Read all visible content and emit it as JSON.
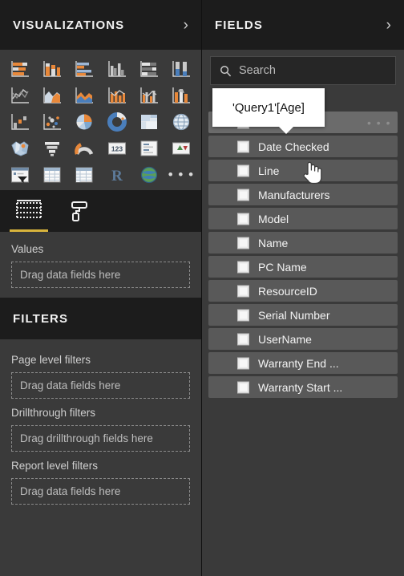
{
  "visualizations": {
    "title": "VISUALIZATIONS",
    "collapse_icon": "chevron-right-icon",
    "chevron": "›",
    "icons": [
      {
        "name": "stacked-bar-chart",
        "kind": "stacked-bar"
      },
      {
        "name": "stacked-column-chart",
        "kind": "stacked-column"
      },
      {
        "name": "clustered-bar-chart",
        "kind": "clustered-bar"
      },
      {
        "name": "clustered-column-chart",
        "kind": "clustered-column"
      },
      {
        "name": "hundred-percent-stacked-bar-chart",
        "kind": "pct-bar"
      },
      {
        "name": "hundred-percent-stacked-column-chart",
        "kind": "pct-column"
      },
      {
        "name": "line-chart",
        "kind": "line"
      },
      {
        "name": "area-chart",
        "kind": "area"
      },
      {
        "name": "stacked-area-chart",
        "kind": "stacked-area"
      },
      {
        "name": "line-and-stacked-column-chart",
        "kind": "line-stacked-column"
      },
      {
        "name": "line-and-clustered-column-chart",
        "kind": "line-clustered-column"
      },
      {
        "name": "ribbon-chart",
        "kind": "ribbon"
      },
      {
        "name": "waterfall-chart",
        "kind": "waterfall"
      },
      {
        "name": "scatter-chart",
        "kind": "scatter"
      },
      {
        "name": "pie-chart",
        "kind": "pie"
      },
      {
        "name": "donut-chart",
        "kind": "donut"
      },
      {
        "name": "treemap-chart",
        "kind": "treemap"
      },
      {
        "name": "map-chart",
        "kind": "globe"
      },
      {
        "name": "filled-map-chart",
        "kind": "filled-map"
      },
      {
        "name": "funnel-chart",
        "kind": "funnel"
      },
      {
        "name": "gauge-chart",
        "kind": "gauge"
      },
      {
        "name": "card-visual",
        "kind": "card123"
      },
      {
        "name": "multi-row-card-visual",
        "kind": "multirow"
      },
      {
        "name": "kpi-visual",
        "kind": "kpi"
      },
      {
        "name": "slicer-visual",
        "kind": "slicer"
      },
      {
        "name": "table-visual",
        "kind": "table"
      },
      {
        "name": "matrix-visual",
        "kind": "matrix"
      },
      {
        "name": "r-script-visual",
        "kind": "rscript"
      },
      {
        "name": "arcgis-maps-visual",
        "kind": "arcgis"
      },
      {
        "name": "more-visuals",
        "kind": "dots",
        "glyph": "• • •"
      }
    ],
    "tabs": [
      {
        "name": "fields-tab",
        "icon": "fields-grid-icon",
        "active": true
      },
      {
        "name": "format-tab",
        "icon": "paint-roller-icon",
        "active": false
      }
    ],
    "wells": [
      {
        "label": "Values",
        "placeholder": "Drag data fields here"
      }
    ]
  },
  "filters": {
    "title": "FILTERS",
    "groups": [
      {
        "label": "Page level filters",
        "placeholder": "Drag data fields here"
      },
      {
        "label": "Drillthrough filters",
        "placeholder": "Drag drillthrough fields here"
      },
      {
        "label": "Report level filters",
        "placeholder": "Drag data fields here"
      }
    ]
  },
  "fields": {
    "title": "FIELDS",
    "collapse_icon": "chevron-right-icon",
    "chevron": "›",
    "search": {
      "placeholder": "Search",
      "value": "",
      "icon": "search-icon"
    },
    "table_name": "Query1",
    "items": [
      {
        "name": "Age",
        "highlighted": true,
        "has_date_icon": true,
        "has_more": true,
        "more_glyph": "• • •"
      },
      {
        "name": "Date Checked",
        "highlighted": false,
        "has_date_icon": false,
        "has_more": false
      },
      {
        "name": "Line",
        "highlighted": false,
        "has_date_icon": false,
        "has_more": false
      },
      {
        "name": "Manufacturers",
        "highlighted": false,
        "has_date_icon": false,
        "has_more": false
      },
      {
        "name": "Model",
        "highlighted": false,
        "has_date_icon": false,
        "has_more": false
      },
      {
        "name": "Name",
        "highlighted": false,
        "has_date_icon": false,
        "has_more": false
      },
      {
        "name": "PC Name",
        "highlighted": false,
        "has_date_icon": false,
        "has_more": false
      },
      {
        "name": "ResourceID",
        "highlighted": false,
        "has_date_icon": false,
        "has_more": false
      },
      {
        "name": "Serial Number",
        "highlighted": false,
        "has_date_icon": false,
        "has_more": false
      },
      {
        "name": "UserName",
        "highlighted": false,
        "has_date_icon": false,
        "has_more": false
      },
      {
        "name": "Warranty End ...",
        "highlighted": false,
        "has_date_icon": false,
        "has_more": false
      },
      {
        "name": "Warranty Start ...",
        "highlighted": false,
        "has_date_icon": false,
        "has_more": false
      }
    ]
  },
  "tooltip": {
    "text": "'Query1'[Age]"
  },
  "cursor": {
    "icon": "pointing-hand-cursor"
  },
  "colors": {
    "panel_bg": "#3a3a3a",
    "header_bg": "#1c1c1c",
    "row_bg": "#595959",
    "row_hl_bg": "#6b6b6b",
    "accent_tab": "#d8b43c",
    "chart_orange": "#e8883a",
    "chart_blue": "#4a7ebb"
  }
}
